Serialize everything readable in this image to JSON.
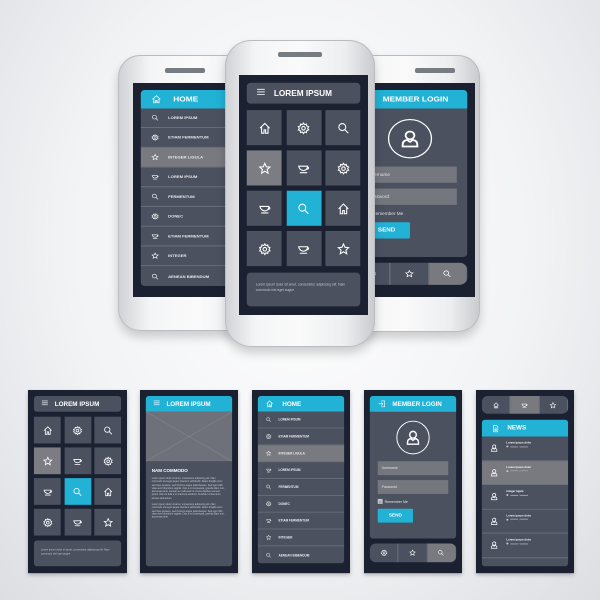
{
  "colors": {
    "accent": "#21b2d6",
    "background": "#1b2131",
    "panel": "#4b515f",
    "highlight": "#787a80",
    "phone": "#f4f5f6"
  },
  "grid": {
    "title": "LOREM IPSUM",
    "menu_icon": "hamburger-icon",
    "tiles": [
      {
        "icon": "home"
      },
      {
        "icon": "gear"
      },
      {
        "icon": "search"
      },
      {
        "icon": "star",
        "state": "highlight"
      },
      {
        "icon": "cup"
      },
      {
        "icon": "gear"
      },
      {
        "icon": "cup"
      },
      {
        "icon": "search",
        "state": "active"
      },
      {
        "icon": "home"
      },
      {
        "icon": "gear"
      },
      {
        "icon": "cup"
      },
      {
        "icon": "star"
      }
    ],
    "footer": "Lorem ipsum dolor sit amet, consectetur adipiscing elit. Nam commodo nisl eget augue"
  },
  "list": {
    "title": "HOME",
    "title_icon": "home",
    "items": [
      {
        "label": "LOREM IPSUM",
        "icon": "search"
      },
      {
        "label": "ETIAM FERMENTUM",
        "icon": "gear"
      },
      {
        "label": "INTEGER LIGULA",
        "icon": "star",
        "state": "highlight"
      },
      {
        "label": "LOREM IPSUM",
        "icon": "cup"
      },
      {
        "label": "FERMENTUM",
        "icon": "search"
      },
      {
        "label": "DONEC",
        "icon": "gear"
      },
      {
        "label": "ETIAM FERMENTUM",
        "icon": "cup"
      },
      {
        "label": "INTEGER",
        "icon": "star"
      },
      {
        "label": "AENEAN BIBENDUM",
        "icon": "search"
      }
    ]
  },
  "login": {
    "title": "MEMBER LOGIN",
    "title_icon": "login",
    "username_placeholder": "Username",
    "password_placeholder": "Password",
    "remember": "Remember Me",
    "remember_checked": true,
    "send": "SEND",
    "tabs": [
      {
        "icon": "gear"
      },
      {
        "icon": "star"
      },
      {
        "icon": "search",
        "state": "highlight"
      }
    ]
  },
  "article": {
    "title": "LOREM IPSUM",
    "heading": "NAM COMMODO",
    "paragraphs": [
      "Lorem ipsum dolor sit amet, consectetur adipiscing elit. Nam commodo nisl eget augue interdum sollicitudin. Etiam fringilla nunc sed risus posuere, sed rhoncus augue pellentesque. Sed eget nibh vitae sem bibendum sagittis. Duis a mi consequat, gravida diam non, accumsan ante. Aenean eu nulla sed mi cursus dapibus sed sed ipsum. Nam at felis a mi maximus eleifend. Curabitur consectetur laoreet elementum.",
      "Lorem ipsum dolor sit amet, consectetur adipiscing elit. Nam commodo nisl eget augue interdum sollicitudin. Etiam fringilla nunc sed risus posuere, sed rhoncus augue pellentesque. Sed eget nibh vitae sem bibendum sagittis. Duis a mi consequat, gravida diam non, accumsan ante."
    ]
  },
  "news": {
    "title": "NEWS",
    "title_icon": "news",
    "tabs": [
      {
        "icon": "home"
      },
      {
        "icon": "cup",
        "state": "highlight"
      },
      {
        "icon": "star"
      }
    ],
    "items": [
      {
        "title": "Lorem ipsum dolor"
      },
      {
        "title": "Lorem ipsum dolor",
        "state": "highlight"
      },
      {
        "title": "Integer ligula"
      },
      {
        "title": "Lorem ipsum dolor"
      },
      {
        "title": "Lorem ipsum dolor"
      }
    ]
  }
}
